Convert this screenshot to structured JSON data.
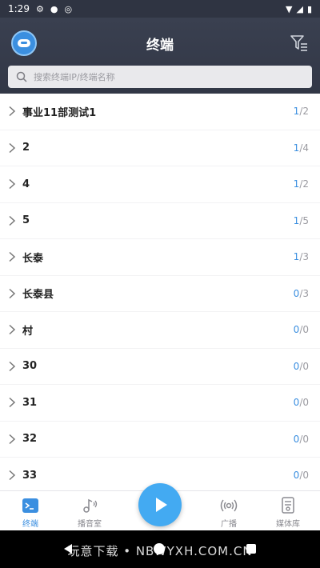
{
  "status_bar": {
    "time": "1:29"
  },
  "header": {
    "title": "终端",
    "search_placeholder": "搜索终端IP/终端名称"
  },
  "terminals": [
    {
      "name": "事业11部测试1",
      "online": "1",
      "total": "2"
    },
    {
      "name": "2",
      "online": "1",
      "total": "4"
    },
    {
      "name": "4",
      "online": "1",
      "total": "2"
    },
    {
      "name": "5",
      "online": "1",
      "total": "5"
    },
    {
      "name": "长泰",
      "online": "1",
      "total": "3"
    },
    {
      "name": "长泰县",
      "online": "0",
      "total": "3"
    },
    {
      "name": "村",
      "online": "0",
      "total": "0"
    },
    {
      "name": "30",
      "online": "0",
      "total": "0"
    },
    {
      "name": "31",
      "online": "0",
      "total": "0"
    },
    {
      "name": "32",
      "online": "0",
      "total": "0"
    },
    {
      "name": "33",
      "online": "0",
      "total": "0"
    }
  ],
  "tabs": {
    "terminal": "终端",
    "broadcast_room": "播音室",
    "broadcast": "广播",
    "media_library": "媒体库"
  },
  "watermark": "玩意下载 • NBWYXH.COM.CN",
  "colors": {
    "accent": "#3b8fe0",
    "header_bg": "#363b4a",
    "play_button": "#43aaf2"
  }
}
